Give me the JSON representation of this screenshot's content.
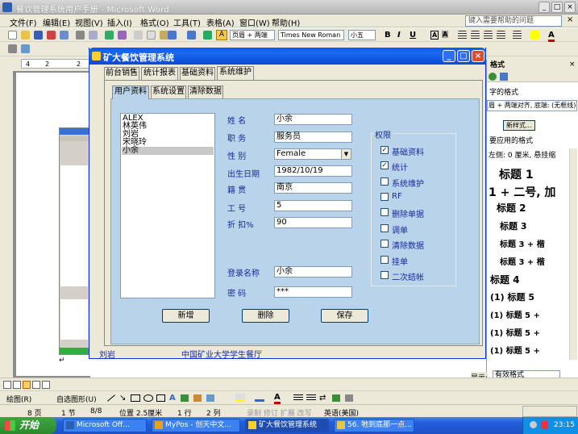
{
  "word": {
    "title": "餐饮管理系统用户手册 - Microsoft Word",
    "menu": [
      "文件(F)",
      "编辑(E)",
      "视图(V)",
      "插入(I)",
      "格式(O)",
      "工具(T)",
      "表格(A)",
      "窗口(W)",
      "帮助(H)"
    ],
    "help_placeholder": "键入需要帮助的问题",
    "style_combo": "页眉 + 两端",
    "font_combo": "Times New Roman",
    "size_combo": "小五",
    "ruler_nums": [
      "4",
      "2",
      "2"
    ],
    "view_status": {
      "page": "8 页",
      "section": "1 节",
      "pages": "8/8",
      "position": "位置 2.5厘米",
      "line": "1 行",
      "column": "2 列",
      "flags": "录制 修订 扩展 改写",
      "lang": "英语(美国)"
    },
    "draw_bar": {
      "draw": "绘图(R)",
      "autoshape": "自选图形(U)"
    }
  },
  "taskpane": {
    "header": "格式",
    "items": [
      "字的格式",
      "眉 + 两端对齐, 底端: (无框线)",
      "新样式...",
      "要应用的格式",
      "左侧: 0 厘米, 悬挂缩",
      "标题 1",
      "1 + 二号, 加",
      "标题 2",
      "标题 3",
      "标题 3 + 楷",
      "标题 3 + 楷",
      "标题 4",
      "(1) 标题 5",
      "(1) 标题 5 +",
      "(1) 标题 5 +",
      "(1) 标题 5 +"
    ],
    "show_label": "显示:",
    "show_value": "有效格式"
  },
  "app": {
    "title": "矿大餐饮管理系统",
    "main_tabs": [
      "前台销售",
      "统计报表",
      "基础资料",
      "系统维护"
    ],
    "sub_tabs": [
      "用户资料",
      "系统设置",
      "清除数据"
    ],
    "users": [
      "ALEX",
      "林英伟",
      "刘岩",
      "宋晓玲",
      "小余"
    ],
    "form": {
      "name_label": "姓    名",
      "name_value": "小余",
      "position_label": "职    务",
      "position_value": "服务员",
      "gender_label": "性    别",
      "gender_value": "Female",
      "birth_label": "出生日期",
      "birth_value": "1982/10/19",
      "native_label": "籍    贯",
      "native_value": "南京",
      "id_label": "工    号",
      "id_value": "5",
      "discount_label": "折    扣%",
      "discount_value": "90",
      "login_label": "登录名称",
      "login_value": "小余",
      "password_label": "密    码",
      "password_value": "***"
    },
    "permissions_title": "权限",
    "permissions": [
      {
        "label": "基础资料",
        "mark": "✓"
      },
      {
        "label": "统计",
        "mark": "✓"
      },
      {
        "label": "系统维护",
        "mark": ""
      },
      {
        "label": "RF",
        "mark": ""
      },
      {
        "label": "删除单据",
        "mark": ""
      },
      {
        "label": "调单",
        "mark": ""
      },
      {
        "label": "清除数据",
        "mark": ""
      },
      {
        "label": "挂单",
        "mark": ""
      },
      {
        "label": "二次结帐",
        "mark": ""
      }
    ],
    "buttons": {
      "add": "新增",
      "delete": "删除",
      "save": "保存"
    },
    "footer_left": "刘岩",
    "footer_center": "中国矿业大学学生餐厅"
  },
  "taskbar": {
    "start": "开始",
    "tasks": [
      "Microsoft Off...",
      "MyPos - 创天中文...",
      "矿大餐饮管理系统",
      "56. 牠到底那一点..."
    ],
    "clock": "23:15"
  },
  "colors": {
    "xp_blue": "#0a58e8",
    "panel_blue": "#b9d3ea",
    "label_blue": "#1a2a9a"
  }
}
